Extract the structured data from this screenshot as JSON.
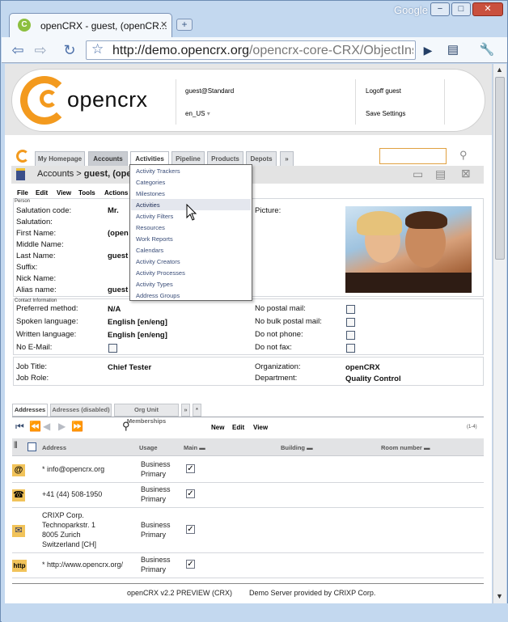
{
  "browser": {
    "brand": "Google",
    "tab_title": "openCRX - guest, (openCR...",
    "url_host": "http://demo.opencrx.org",
    "url_path": "/opencrx-core-CRX/ObjectInspect",
    "minimize": "−",
    "maximize": "□",
    "close": "✕"
  },
  "header": {
    "logo_text": "opencrx",
    "user": "guest@Standard",
    "locale": "en_US",
    "logoff": "Logoff guest",
    "save_settings": "Save Settings"
  },
  "nav_tabs": [
    "My Homepage",
    "Accounts",
    "Activities",
    "Pipeline",
    "Products",
    "Depots",
    "»"
  ],
  "breadcrumb": {
    "root": "Accounts",
    "sep": " > ",
    "current": "guest, (open"
  },
  "menu_bar": [
    "File",
    "Edit",
    "View",
    "Tools",
    "Actions"
  ],
  "dropdown": {
    "items": [
      "Activity Trackers",
      "Categories",
      "Milestones",
      "Activities",
      "Activity Filters",
      "Resources",
      "Work Reports",
      "Calendars",
      "Activity Creators",
      "Activity Processes",
      "Activity Types",
      "Address Groups"
    ],
    "highlighted_index": 3
  },
  "person": {
    "section": "Person",
    "labels": [
      "Salutation code:",
      "Salutation:",
      "First Name:",
      "Middle Name:",
      "Last Name:",
      "Suffix:",
      "Nick Name:",
      "Alias name:"
    ],
    "values": [
      "Mr.",
      "",
      "(open",
      "",
      "guest",
      "",
      "",
      "guest"
    ],
    "picture_label": "Picture:"
  },
  "contact": {
    "section": "Contact Information",
    "preferred_method_label": "Preferred method:",
    "preferred_method": "N/A",
    "spoken_label": "Spoken language:",
    "spoken": "English [en/eng]",
    "written_label": "Written language:",
    "written": "English [en/eng]",
    "no_email_label": "No E-Mail:",
    "no_postal_label": "No postal mail:",
    "no_bulk_label": "No bulk postal mail:",
    "no_phone_label": "Do not phone:",
    "no_fax_label": "Do not fax:"
  },
  "job": {
    "title_label": "Job Title:",
    "title": "Chief Tester",
    "role_label": "Job Role:",
    "org_label": "Organization:",
    "org": "openCRX",
    "dept_label": "Department:",
    "dept": "Quality Control"
  },
  "bottom_tabs": [
    "Addresses",
    "Adresses (disabled)",
    "Org Unit Memberships",
    "»",
    "*"
  ],
  "grid_toolbar": {
    "new": "New",
    "edit": "Edit",
    "view": "View",
    "count": "(1-4)"
  },
  "grid": {
    "columns": [
      "Address",
      "Usage",
      "Main",
      "Building",
      "Room number"
    ],
    "rows": [
      {
        "icon": "@",
        "address": [
          "* info@opencrx.org"
        ],
        "usage": [
          "Business",
          "Primary"
        ],
        "main": true
      },
      {
        "icon": "☎",
        "address": [
          "+41 (44) 508-1950"
        ],
        "usage": [
          "Business",
          "Primary"
        ],
        "main": true
      },
      {
        "icon": "✉",
        "address": [
          "CRIXP Corp.",
          "Technoparkstr. 1",
          "8005 Zurich",
          "Switzerland [CH]"
        ],
        "usage": [
          "Business",
          "Primary"
        ],
        "main": true
      },
      {
        "icon": "http",
        "address": [
          "* http://www.opencrx.org/"
        ],
        "usage": [
          "Business",
          "Primary"
        ],
        "main": true
      }
    ]
  },
  "footer": {
    "version": "openCRX v2.2 PREVIEW (CRX)",
    "server": "Demo Server provided by",
    "provider": "CRIXP Corp."
  },
  "colors": {
    "brand_orange": "#f39a1e",
    "chrome_blue": "#c3d8ef"
  }
}
